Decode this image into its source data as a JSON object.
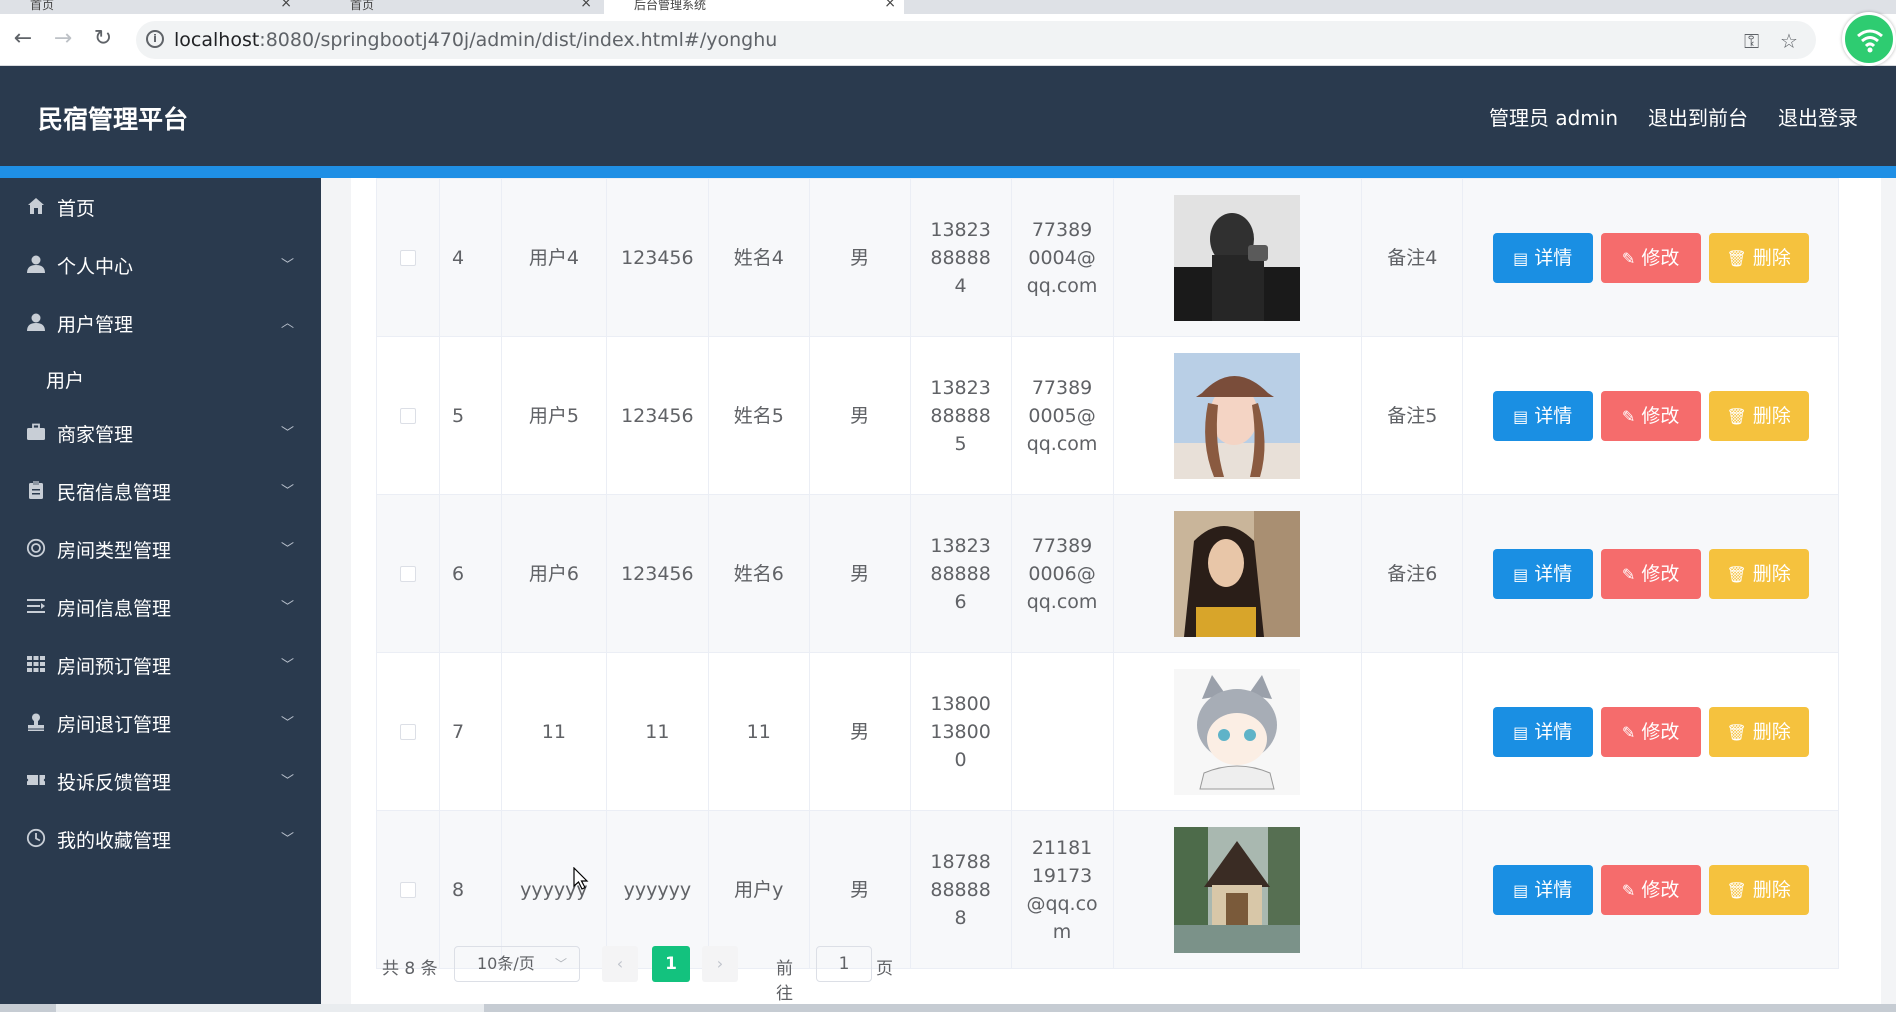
{
  "browser": {
    "tabs": [
      {
        "label": "首页"
      },
      {
        "label": "首页"
      },
      {
        "label": "后台管理系统"
      }
    ],
    "url_host": "localhost",
    "url_path": ":8080/springbootj470j/admin/dist/index.html#/yonghu"
  },
  "header": {
    "title": "民宿管理平台",
    "admin_label": "管理员 admin",
    "to_front_label": "退出到前台",
    "logout_label": "退出登录"
  },
  "sidebar": {
    "items": [
      {
        "label": "首页",
        "icon": "home-icon"
      },
      {
        "label": "个人中心",
        "icon": "user-icon"
      },
      {
        "label": "用户管理",
        "icon": "user-icon"
      },
      {
        "label": "用户",
        "icon": ""
      },
      {
        "label": "商家管理",
        "icon": "briefcase-icon"
      },
      {
        "label": "民宿信息管理",
        "icon": "clipboard-icon"
      },
      {
        "label": "房间类型管理",
        "icon": "lifebuoy-icon"
      },
      {
        "label": "房间信息管理",
        "icon": "list-icon"
      },
      {
        "label": "房间预订管理",
        "icon": "grid-icon"
      },
      {
        "label": "房间退订管理",
        "icon": "stamp-icon"
      },
      {
        "label": "投诉反馈管理",
        "icon": "ticket-icon"
      },
      {
        "label": "我的收藏管理",
        "icon": "clock-icon"
      }
    ]
  },
  "table": {
    "rows": [
      {
        "index": "4",
        "account": "用户4",
        "password": "123456",
        "name": "姓名4",
        "gender": "男",
        "phone": "13823888884",
        "email": "773890004@qq.com",
        "note": "备注4"
      },
      {
        "index": "5",
        "account": "用户5",
        "password": "123456",
        "name": "姓名5",
        "gender": "男",
        "phone": "13823888885",
        "email": "773890005@qq.com",
        "note": "备注5"
      },
      {
        "index": "6",
        "account": "用户6",
        "password": "123456",
        "name": "姓名6",
        "gender": "男",
        "phone": "13823888886",
        "email": "773890006@qq.com",
        "note": "备注6"
      },
      {
        "index": "7",
        "account": "11",
        "password": "11",
        "name": "11",
        "gender": "男",
        "phone": "13800138000",
        "email": "",
        "note": ""
      },
      {
        "index": "8",
        "account": "yyyyyy",
        "password": "yyyyyy",
        "name": "用户y",
        "gender": "男",
        "phone": "18788888888",
        "email": "2118119173@qq.com",
        "note": ""
      }
    ],
    "btn_detail": "详情",
    "btn_edit": "修改",
    "btn_delete": "删除"
  },
  "pager": {
    "total": "共 8 条",
    "page_size": "10条/页",
    "current_page": "1",
    "goto_label": "前往",
    "goto_value": "1",
    "page_suffix": "页"
  }
}
